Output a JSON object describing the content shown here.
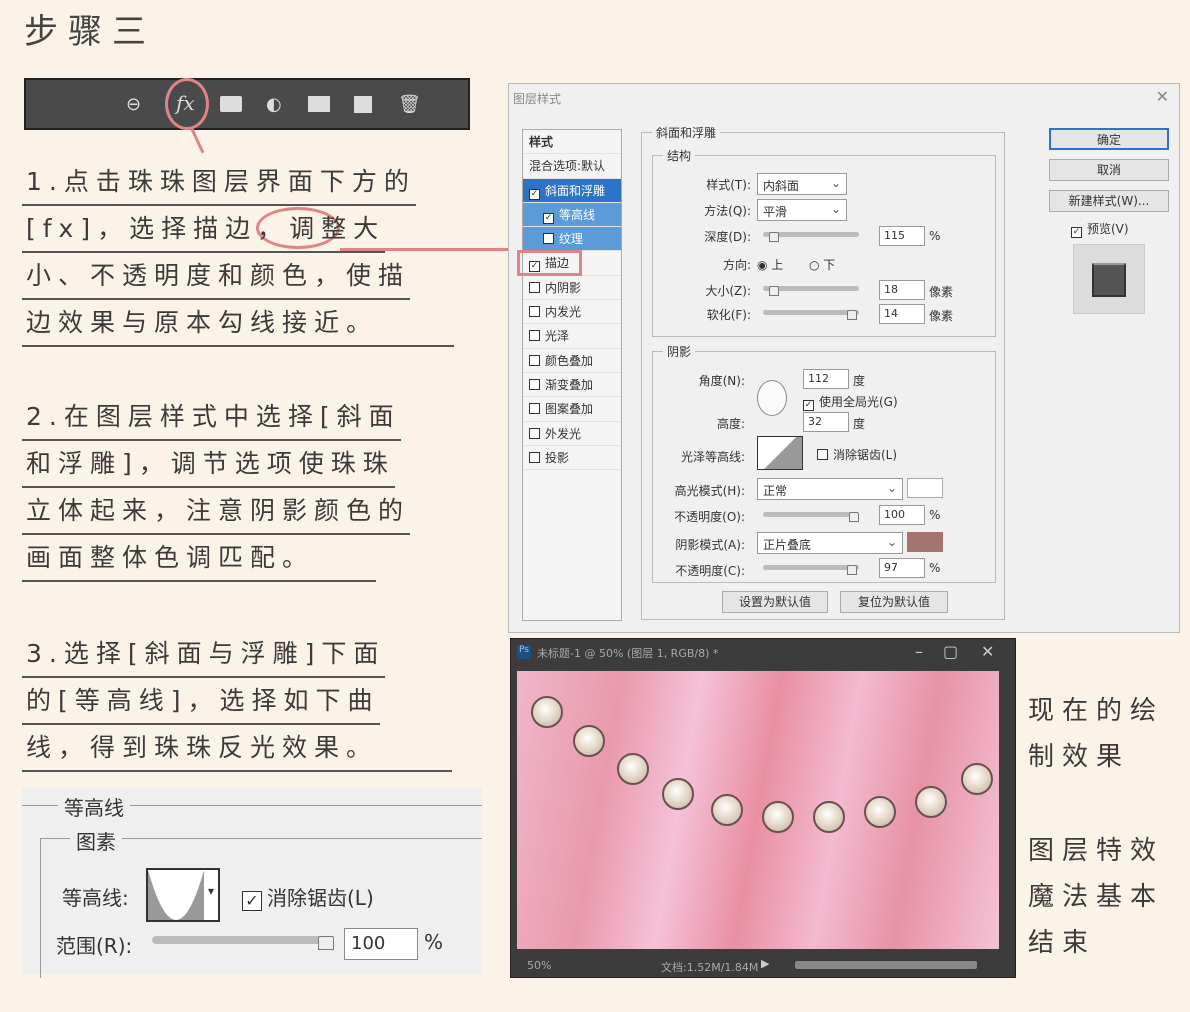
{
  "title": "步骤三",
  "toolbar": {
    "icons": [
      "link-icon",
      "fx-icon",
      "mask-icon",
      "adjustment-icon",
      "folder-icon",
      "new-layer-icon",
      "trash-icon"
    ],
    "fx_label": "fx"
  },
  "steps": [
    {
      "lines": [
        "1.点击珠珠图层界面下方的",
        "[fx]，选择描边，调整大",
        "小、不透明度和颜色，使描",
        "边效果与原本勾线接近。"
      ]
    },
    {
      "lines": [
        "2.在图层样式中选择[斜面",
        "和浮雕]，调节选项使珠珠",
        "立体起来，注意阴影颜色的",
        "画面整体色调匹配。"
      ]
    },
    {
      "lines": [
        "3.选择[斜面与浮雕]下面",
        "的[等高线]，选择如下曲",
        "线，得到珠珠反光效果。"
      ]
    }
  ],
  "side_notes": [
    [
      "现在的绘",
      "制效果"
    ],
    [
      "图层特效",
      "魔法基本",
      "结束"
    ]
  ],
  "dialog": {
    "title": "图层样式",
    "styles_header": "样式",
    "blend_default": "混合选项:默认",
    "effects": [
      {
        "label": "斜面和浮雕",
        "checked": true
      },
      {
        "label": "等高线",
        "checked": true
      },
      {
        "label": "纹理",
        "checked": false
      },
      {
        "label": "描边",
        "checked": true
      },
      {
        "label": "内阴影",
        "checked": false
      },
      {
        "label": "内发光",
        "checked": false
      },
      {
        "label": "光泽",
        "checked": false
      },
      {
        "label": "颜色叠加",
        "checked": false
      },
      {
        "label": "渐变叠加",
        "checked": false
      },
      {
        "label": "图案叠加",
        "checked": false
      },
      {
        "label": "外发光",
        "checked": false
      },
      {
        "label": "投影",
        "checked": false
      }
    ],
    "section": "斜面和浮雕",
    "structure": {
      "legend": "结构",
      "style_label": "样式(T):",
      "style_value": "内斜面",
      "technique_label": "方法(Q):",
      "technique_value": "平滑",
      "depth_label": "深度(D):",
      "depth_value": "115",
      "pct": "%",
      "direction_label": "方向:",
      "dir_up": "上",
      "dir_down": "下",
      "size_label": "大小(Z):",
      "size_value": "18",
      "px": "像素",
      "soften_label": "软化(F):",
      "soften_value": "14"
    },
    "shading": {
      "legend": "阴影",
      "angle_label": "角度(N):",
      "angle_value": "112",
      "deg": "度",
      "global_light": "使用全局光(G)",
      "altitude_label": "高度:",
      "altitude_value": "32",
      "gloss_label": "光泽等高线:",
      "antialias": "消除锯齿(L)",
      "highlight_label": "高光模式(H):",
      "highlight_value": "正常",
      "highlight_color": "#ffffff",
      "hop_label": "不透明度(O):",
      "hop_value": "100",
      "shadow_label": "阴影模式(A):",
      "shadow_value": "正片叠底",
      "shadow_color": "#a47570",
      "sop_label": "不透明度(C):",
      "sop_value": "97"
    },
    "btn_set_default": "设置为默认值",
    "btn_reset_default": "复位为默认值",
    "ok": "确定",
    "cancel": "取消",
    "new_style": "新建样式(W)...",
    "preview": "预览(V)"
  },
  "canvas_window": {
    "title": "未标题-1 @ 50% (图层 1, RGB/8) *",
    "zoom": "50%",
    "doc": "文档:1.52M/1.84M"
  },
  "contour_panel": {
    "legend": "等高线",
    "sub_legend": "图素",
    "contour_label": "等高线:",
    "antialias": "消除锯齿(L)",
    "range_label": "范围(R):",
    "range_value": "100",
    "pct": "%"
  }
}
